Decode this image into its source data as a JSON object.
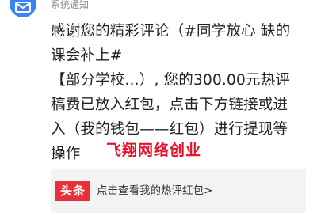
{
  "header": {
    "sender": "系统通知",
    "avatar_icon": "mail-icon",
    "avatar_color": "#3b82f6"
  },
  "message": {
    "lines": [
      "感谢您的精彩评论（#同学放心 缺的",
      "课会补上#",
      "【部分学校...）, 您的300.00元热评",
      "稿费已放入红包，点击下方链接或进",
      "入（我的钱包——红包）进行提现等",
      "操作"
    ]
  },
  "watermark": {
    "text": "飞翔网络创业",
    "color": "#e8102a"
  },
  "card": {
    "logo_text": "头条",
    "logo_color": "#e8303a",
    "link_text": "点击查看我的热评红包>"
  }
}
